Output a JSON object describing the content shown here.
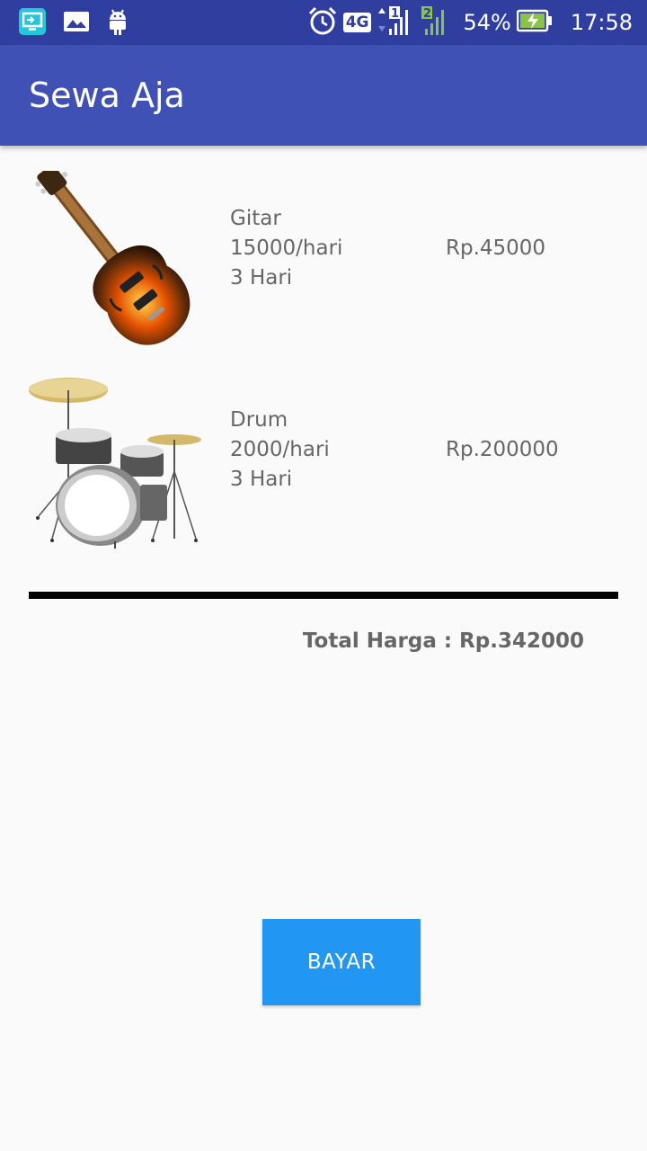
{
  "status_bar": {
    "network": "4G",
    "sim1": "1",
    "sim2": "2",
    "battery": "54%",
    "time": "17:58",
    "icons": [
      "screen-mirror-icon",
      "gallery-icon",
      "android-icon",
      "alarm-icon",
      "signal-icon",
      "battery-charging-icon"
    ]
  },
  "app_bar": {
    "title": "Sewa Aja"
  },
  "items": [
    {
      "icon": "guitar-image",
      "name": "Gitar",
      "rate": "15000/hari",
      "days": "3 Hari",
      "price": "Rp.45000"
    },
    {
      "icon": "drum-image",
      "name": "Drum",
      "rate": "2000/hari",
      "days": "3 Hari",
      "price": "Rp.200000"
    }
  ],
  "total": "Total Harga : Rp.342000",
  "pay_button": "BAYAR",
  "colors": {
    "status_bar": "#303f9f",
    "app_bar": "#3f51b5",
    "button": "#2196f3",
    "text": "#666666"
  }
}
